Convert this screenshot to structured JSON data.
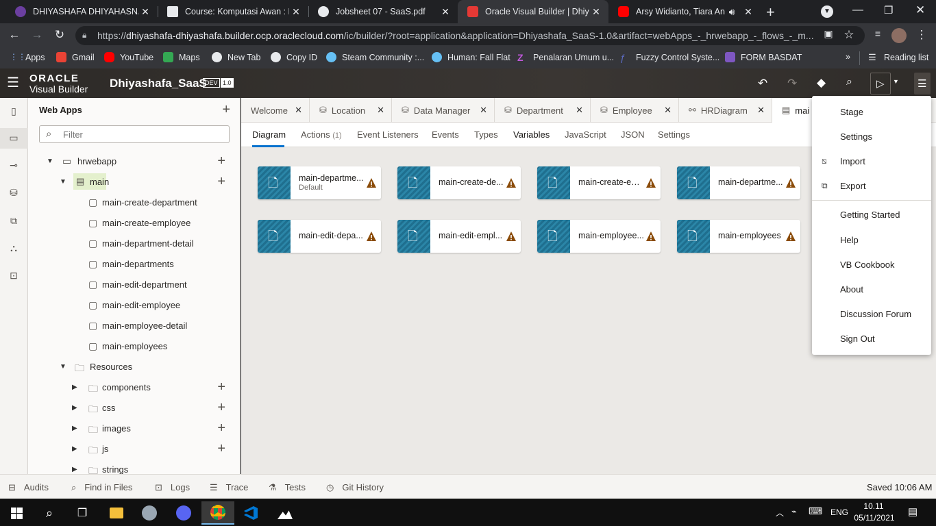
{
  "browser": {
    "tabs": [
      {
        "title": "DHIYASHAFA DHIYAHASNA H",
        "favicon_color": "#6b3fa0"
      },
      {
        "title": "Course: Komputasi Awan : Dip",
        "favicon_color": "#e8eaed"
      },
      {
        "title": "Jobsheet 07 - SaaS.pdf",
        "favicon_color": "#e8eaed"
      },
      {
        "title": "Oracle Visual Builder | Dhiyas",
        "favicon_color": "#e53935"
      },
      {
        "title": "Arsy Widianto, Tiara Andi",
        "favicon_color": "#ff0000"
      }
    ],
    "url_prefix": "https://",
    "url_host": "dhiyashafa-dhiyashafa.builder.ocp.oraclecloud.com",
    "url_path": "/ic/builder/?root=application&application=Dhiyashafa_SaaS-1.0&artifact=webApps_-_hrwebapp_-_flows_-_m...",
    "bookmarks": [
      "Apps",
      "Gmail",
      "YouTube",
      "Maps",
      "New Tab",
      "Copy ID",
      "Steam Community :...",
      "Human: Fall Flat",
      "Penalaran Umum u...",
      "Fuzzy Control Syste...",
      "FORM BASDAT"
    ],
    "reading_list": "Reading list"
  },
  "vb": {
    "logo_top": "ORACLE",
    "logo_bottom": "Visual Builder",
    "app_name": "Dhiyashafa_SaaS",
    "badge_dev": "DEV",
    "badge_version": "1.0"
  },
  "navigator": {
    "title": "Web Apps",
    "filter_placeholder": "Filter",
    "tree": {
      "app": "hrwebapp",
      "flow": "main",
      "pages": [
        "main-create-department",
        "main-create-employee",
        "main-department-detail",
        "main-departments",
        "main-edit-department",
        "main-edit-employee",
        "main-employee-detail",
        "main-employees"
      ],
      "resources": "Resources",
      "folders": [
        "components",
        "css",
        "images",
        "js",
        "strings"
      ]
    }
  },
  "editor": {
    "tabs": [
      "Welcome",
      "Location",
      "Data Manager",
      "Department",
      "Employee",
      "HRDiagram",
      "mai"
    ],
    "subtabs": [
      "Diagram",
      "Actions",
      "Event Listeners",
      "Events",
      "Types",
      "Variables",
      "JavaScript",
      "JSON",
      "Settings"
    ],
    "actions_count": "(1)",
    "cards": [
      {
        "name": "main-departme...",
        "sub": "Default"
      },
      {
        "name": "main-create-de..."
      },
      {
        "name": "main-create-em..."
      },
      {
        "name": "main-departme..."
      },
      {
        "name": "main-edit-depa..."
      },
      {
        "name": "main-edit-empl..."
      },
      {
        "name": "main-employee..."
      },
      {
        "name": "main-employees"
      }
    ]
  },
  "menu": {
    "items": [
      "Stage",
      "Settings",
      "Import",
      "Export",
      "Getting Started",
      "Help",
      "VB Cookbook",
      "About",
      "Discussion Forum",
      "Sign Out"
    ]
  },
  "statusbar": {
    "items": [
      "Audits",
      "Find in Files",
      "Logs",
      "Trace",
      "Tests",
      "Git History"
    ],
    "saved": "Saved 10:06 AM"
  },
  "taskbar": {
    "time": "10.11",
    "date": "05/11/2021",
    "lang": "ENG"
  },
  "colors": {
    "accent": "#0572ce",
    "card_thumb": "#1f6f8f",
    "warning": "#8a4b08"
  }
}
